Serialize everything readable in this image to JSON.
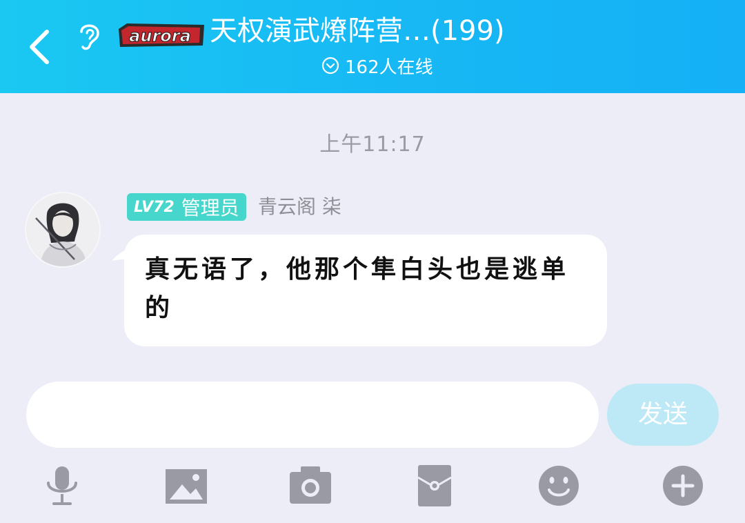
{
  "header": {
    "logo_text": "aurora",
    "group_title": "天权演武燎阵营…(199)",
    "online_status": "162人在线"
  },
  "chat": {
    "timestamp": "上午11:17",
    "messages": [
      {
        "level": "LV72",
        "role": "管理员",
        "sender": "青云阁 柒",
        "text": "真无语了，他那个隼白头也是逃单的"
      }
    ]
  },
  "composer": {
    "input_value": "",
    "send_label": "发送"
  },
  "toolbar": {
    "icons": [
      "microphone-icon",
      "image-icon",
      "camera-icon",
      "red-packet-icon",
      "emoji-icon",
      "plus-icon"
    ]
  },
  "colors": {
    "header_start": "#1ac8f2",
    "header_end": "#15b0f6",
    "background": "#ecedf6",
    "level_badge": "#47d6cc",
    "send_button": "#bde9f7",
    "toolbar_icon": "#9a9aa4"
  }
}
